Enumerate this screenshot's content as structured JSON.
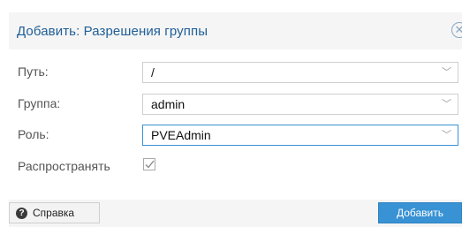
{
  "dialog": {
    "title": "Добавить: Разрешения группы",
    "close_icon": "close-circle-icon"
  },
  "form": {
    "path": {
      "label": "Путь:",
      "value": "/"
    },
    "group": {
      "label": "Группа:",
      "value": "admin"
    },
    "role": {
      "label": "Роль:",
      "value": "PVEAdmin"
    },
    "propagate": {
      "label": "Распространять",
      "checked": true
    }
  },
  "footer": {
    "help_label": "Справка",
    "help_icon": "question-circle-icon",
    "add_label": "Добавить"
  },
  "colors": {
    "accent": "#3892d4",
    "title": "#1f5e96"
  }
}
